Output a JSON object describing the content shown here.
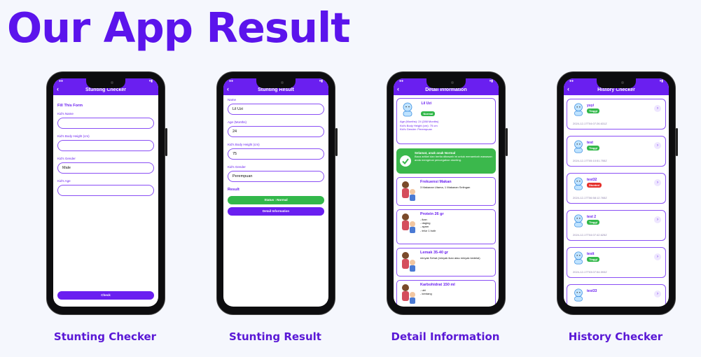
{
  "headline": "Our App Result",
  "captions": [
    "Stunting Checker",
    "Stunting Result",
    "Detail Information",
    "History Checker"
  ],
  "colors": {
    "brand": "#6a1ff0",
    "headline": "#5b14ec",
    "green": "#32b84a",
    "red": "#e5312c"
  },
  "checker": {
    "title": "Stunting Checker",
    "form_title": "Fill This Form",
    "fields": [
      {
        "label": "Kid's Name",
        "value": ""
      },
      {
        "label": "Kid's Body Height (cm)",
        "value": ""
      },
      {
        "label": "Kid's Gender",
        "value": "Male"
      },
      {
        "label": "Kid's Age",
        "value": ""
      }
    ],
    "check_label": "Check"
  },
  "result": {
    "title": "Stunting Result",
    "fields": [
      {
        "label": "Name",
        "value": "Lil Uzi"
      },
      {
        "label": "Age (Months)",
        "value": "24"
      },
      {
        "label": "Kid's Body Height (cm)",
        "value": "75"
      },
      {
        "label": "Kid's Gender",
        "value": "Perempuan"
      }
    ],
    "result_title": "Result",
    "status_label": "Status : Normal",
    "detail_label": "Detail Information"
  },
  "detail": {
    "title": "Detail Information",
    "name": "Lil Uzi",
    "status": "Normal",
    "info_lines": [
      "Age (Months): 24 (288 Months)",
      "Kid's Body Height (cm): 75 cm",
      "Kid's Gender: Perempuan"
    ],
    "banner_title": "Selamat, anak anak Normal",
    "banner_body": "Baca artikel dan berita dibawah ini untuk menambah wawasan anda mengenai pencegahan stunting.",
    "nutrition": [
      {
        "title": "Frekuensi Makan",
        "body": "3 Makanan Utama, 1 Makanan Selingan"
      },
      {
        "title": "Protein 26 gr",
        "body": "- ikan\n- daging\n- ayam\n- telur 1 butir"
      },
      {
        "title": "Lemak 35-40 gr",
        "body": "minyak Sehat (minyak ikan atau minyak kedelai)"
      },
      {
        "title": "Karbohidrat 150 ml",
        "body": "- ubi\n- kentang"
      }
    ]
  },
  "history": {
    "title": "History Checker",
    "items": [
      {
        "name": "yuyi",
        "status": "Tinggi",
        "status_color": "green",
        "date": "2024-12-17T04:07:26.631Z"
      },
      {
        "name": "test",
        "status": "Tinggi",
        "status_color": "green",
        "date": "2024-12-17T05:10:51.755Z"
      },
      {
        "name": "test32",
        "status": "Stunted",
        "status_color": "red",
        "date": "2024-12-17T06:58:12.765Z"
      },
      {
        "name": "test 2",
        "status": "Tinggi",
        "status_color": "green",
        "date": "2024-12-17T04:07:42.625Z"
      },
      {
        "name": "testt",
        "status": "Tinggi",
        "status_color": "green",
        "date": "2024-12-17T03:07:54.593Z"
      },
      {
        "name": "test33",
        "status": "",
        "status_color": "green",
        "date": ""
      }
    ]
  }
}
